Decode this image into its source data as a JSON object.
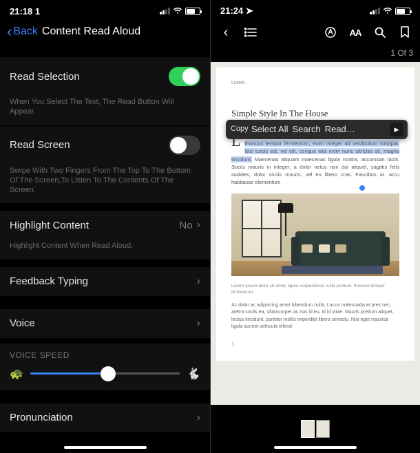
{
  "left": {
    "status": {
      "time": "21:18 1",
      "carrier": "",
      "battery": ""
    },
    "nav": {
      "back": "Back",
      "title": "Content Read Aloud"
    },
    "readSelection": {
      "label": "Read Selection",
      "desc": "When You Select The Text, The Read Button Will Appear."
    },
    "readScreen": {
      "label": "Read Screen",
      "desc": "Swipe With Two Fingers From The Top To The Bottom Of The Screen,To Listen To The Contents Of The Screen."
    },
    "highlight": {
      "label": "Highlight Content",
      "value": "No",
      "desc": "Highlight Content When Read Aloud."
    },
    "feedback": {
      "label": "Feedback Typing"
    },
    "voice": {
      "label": "Voice"
    },
    "speed": {
      "label": "VOICE SPEED",
      "slow_icon": "🐢",
      "fast_icon": "🐇"
    },
    "pronunciation": {
      "label": "Pronunciation"
    }
  },
  "right": {
    "status": {
      "time": "21:24 ➤"
    },
    "pageCounter": "1 Of 3",
    "doc": {
      "header_small": "Lorem",
      "title": "Simple Style In The House",
      "callout": {
        "copy": "Copy",
        "selectAll": "Select All",
        "search": "Search",
        "read": "Read…",
        "arrow": "▶"
      },
      "dropcap": "L",
      "para_selected": "orem ipsum dolor sit amet, ligula suspendisse nulla pretium, rhoncus tempor fermentum, enim integer ad vestibulum volutpat. Nisl turpis est, vel elit, congue wisi enim nunc ultricies sit, magna tincidunt.",
      "para_rest": " Maecenas aliquam maecenas ligula nostra, accumsan taciti. Sociis mauris in integer, a dolor netus non dui aliquet, sagittis felis sodales, dolor sociis mauris, vel eu libero cras. Faucibus at. Arcu habitasse elementum",
      "caption": "Lorem ipsum dolor sit amet, ligula suspendisse nulla pretium, rhoncus tempor fermentum.",
      "para2": "Ac dolor ac adipiscing amet bibendum nulla, Lacus malesuada et pres nec, aretra sociis ea, ullamcorper ac nos id eu, id id vitae. Mauris pretium aliquet, lectus tincidunt, porttitor mollis imperdiet libero senectu. Nisi eget maurisa ligula lacreet vehicula elfend.",
      "pagenum": "1"
    }
  }
}
